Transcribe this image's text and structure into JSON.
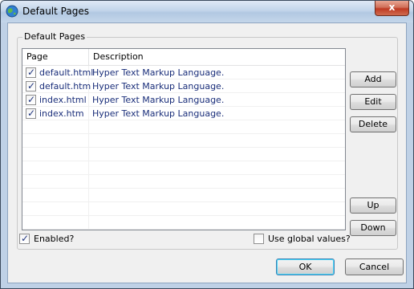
{
  "window": {
    "title": "Default Pages",
    "close_glyph": "x"
  },
  "group": {
    "label": "Default Pages"
  },
  "list": {
    "columns": [
      "Page",
      "Description"
    ],
    "rows": [
      {
        "checked": true,
        "page": "default.html",
        "description": "Hyper Text Markup Language."
      },
      {
        "checked": true,
        "page": "default.htm",
        "description": "Hyper Text Markup Language."
      },
      {
        "checked": true,
        "page": "index.html",
        "description": "Hyper Text Markup Language."
      },
      {
        "checked": true,
        "page": "index.htm",
        "description": "Hyper Text Markup Language."
      }
    ]
  },
  "side_buttons": {
    "add": "Add",
    "edit": "Edit",
    "delete": "Delete",
    "up": "Up",
    "down": "Down"
  },
  "options": {
    "enabled": {
      "label": "Enabled?",
      "checked": true
    },
    "use_global": {
      "label": "Use global values?",
      "checked": false
    }
  },
  "footer": {
    "ok": "OK",
    "cancel": "Cancel"
  },
  "colors": {
    "accent": "#1a2e7a",
    "title_bg": "#bfd1e6",
    "close_red": "#c73a23"
  },
  "icons": {
    "app": "globe-icon",
    "check": "checkmark-icon"
  }
}
